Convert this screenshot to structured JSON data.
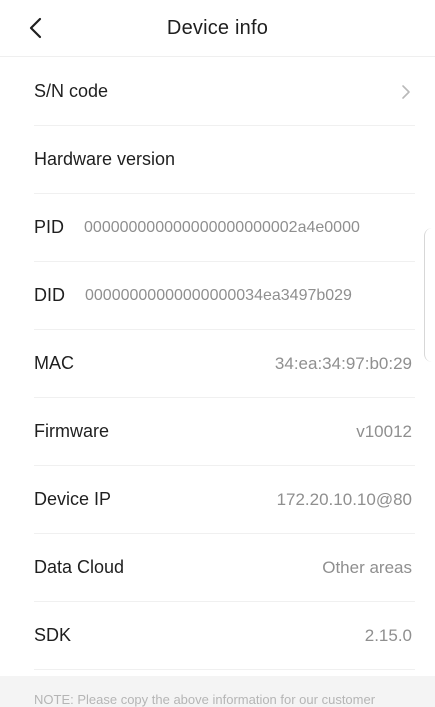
{
  "header": {
    "title": "Device info",
    "back_icon": "chevron-left-icon"
  },
  "rows": [
    {
      "label": "S/N code",
      "has_chevron": true
    },
    {
      "label": "Hardware version"
    },
    {
      "label": "PID",
      "value": "000000000000000000000002a4e0000"
    },
    {
      "label": "DID",
      "value": "00000000000000000034ea3497b029"
    },
    {
      "label": "MAC",
      "value": "34:ea:34:97:b0:29"
    },
    {
      "label": "Firmware",
      "value": "v10012"
    },
    {
      "label": "Device IP",
      "value": "172.20.10.10@80"
    },
    {
      "label": "Data Cloud",
      "value": "Other areas"
    },
    {
      "label": "SDK",
      "value": "2.15.0"
    }
  ],
  "note": "NOTE: Please copy the above information for our customer"
}
